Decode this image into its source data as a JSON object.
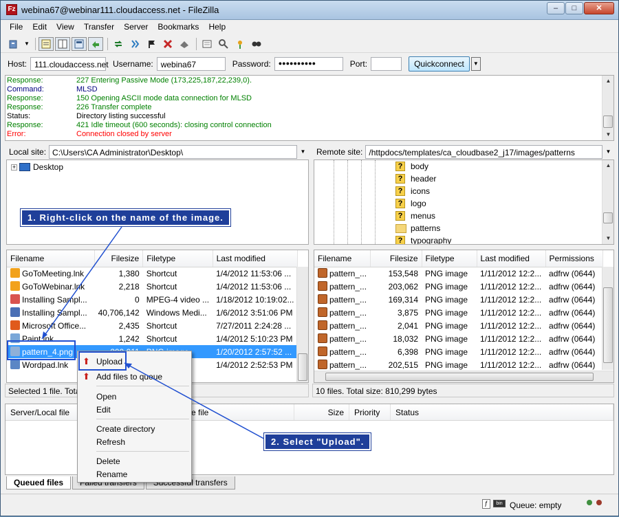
{
  "window": {
    "title": "webina67@webinar111.cloudaccess.net - FileZilla",
    "app_icon": "filezilla-icon",
    "minimize": "–",
    "maximize": "□",
    "close": "✕"
  },
  "menu": [
    "File",
    "Edit",
    "View",
    "Transfer",
    "Server",
    "Bookmarks",
    "Help"
  ],
  "toolbar": {
    "icons": [
      "site-manager-icon",
      "dropdown-icon",
      "message-log-icon",
      "tree-icon",
      "remote-tree-icon",
      "queue-icon",
      "refresh-icon",
      "process-queue-icon",
      "cancel-icon",
      "disconnect-icon",
      "reconnect-icon",
      "filter-icon",
      "compare-icon",
      "sync-browse-icon",
      "search-icon"
    ]
  },
  "quickconnect": {
    "host_label": "Host:",
    "host": "111.cloudaccess.net",
    "user_label": "Username:",
    "user": "webina67",
    "pass_label": "Password:",
    "pass": "●●●●●●●●●●",
    "port_label": "Port:",
    "port": "",
    "button": "Quickconnect"
  },
  "log": [
    {
      "k": "Response:",
      "v": "227 Entering Passive Mode (173,225,187,22,239,0).",
      "c": "#008000"
    },
    {
      "k": "Command:",
      "v": "MLSD",
      "c": "#000080"
    },
    {
      "k": "Response:",
      "v": "150 Opening ASCII mode data connection for MLSD",
      "c": "#008000"
    },
    {
      "k": "Response:",
      "v": "226 Transfer complete",
      "c": "#008000"
    },
    {
      "k": "Status:",
      "v": "Directory listing successful",
      "c": "#000000"
    },
    {
      "k": "Response:",
      "v": "421 Idle timeout (600 seconds): closing control connection",
      "c": "#008000"
    },
    {
      "k": "Error:",
      "v": "Connection closed by server",
      "c": "#ff0000"
    }
  ],
  "local": {
    "label": "Local site:",
    "path": "C:\\Users\\CA Administrator\\Desktop\\",
    "tree_item": "Desktop",
    "headers": [
      "Filename",
      "Filesize",
      "Filetype",
      "Last modified"
    ],
    "files": [
      {
        "name": "GoToMeeting.lnk",
        "size": "1,380",
        "type": "Shortcut",
        "mod": "1/4/2012 11:53:06 ...",
        "color": "#f2a21b"
      },
      {
        "name": "GoToWebinar.lnk",
        "size": "2,218",
        "type": "Shortcut",
        "mod": "1/4/2012 11:53:06 ...",
        "color": "#f2a21b"
      },
      {
        "name": "Installing Sampl...",
        "size": "0",
        "type": "MPEG-4 video ...",
        "mod": "1/18/2012 10:19:02...",
        "color": "#d9534f"
      },
      {
        "name": "Installing Sampl...",
        "size": "40,706,142",
        "type": "Windows Medi...",
        "mod": "1/6/2012 3:51:06 PM",
        "color": "#4a6fb5"
      },
      {
        "name": "Microsoft Office...",
        "size": "2,435",
        "type": "Shortcut",
        "mod": "7/27/2011 2:24:28 ...",
        "color": "#e05a1c"
      },
      {
        "name": "Paint.lnk",
        "size": "1,242",
        "type": "Shortcut",
        "mod": "1/4/2012 5:10:23 PM",
        "color": "#7aa7d8"
      },
      {
        "name": "pattern_4.png",
        "size": "200,011",
        "type": "PNG image",
        "mod": "1/20/2012 2:57:52 ...",
        "color": "#8fb0d8"
      },
      {
        "name": "Wordpad.lnk",
        "size": "",
        "type": "",
        "mod": "1/4/2012 2:52:53 PM",
        "color": "#5b86c5"
      }
    ],
    "status": "Selected 1 file. Tota"
  },
  "remote": {
    "label": "Remote site:",
    "path": "/httpdocs/templates/ca_cloudbase2_j17/images/patterns",
    "tree": [
      "body",
      "header",
      "icons",
      "logo",
      "menus",
      "patterns",
      "typography"
    ],
    "headers": [
      "Filename",
      "Filesize",
      "Filetype",
      "Last modified",
      "Permissions"
    ],
    "files": [
      {
        "name": "pattern_...",
        "size": "153,548",
        "type": "PNG image",
        "mod": "1/11/2012 12:2...",
        "perm": "adfrw (0644)"
      },
      {
        "name": "pattern_...",
        "size": "203,062",
        "type": "PNG image",
        "mod": "1/11/2012 12:2...",
        "perm": "adfrw (0644)"
      },
      {
        "name": "pattern_...",
        "size": "169,314",
        "type": "PNG image",
        "mod": "1/11/2012 12:2...",
        "perm": "adfrw (0644)"
      },
      {
        "name": "pattern_...",
        "size": "3,875",
        "type": "PNG image",
        "mod": "1/11/2012 12:2...",
        "perm": "adfrw (0644)"
      },
      {
        "name": "pattern_...",
        "size": "2,041",
        "type": "PNG image",
        "mod": "1/11/2012 12:2...",
        "perm": "adfrw (0644)"
      },
      {
        "name": "pattern_...",
        "size": "18,032",
        "type": "PNG image",
        "mod": "1/11/2012 12:2...",
        "perm": "adfrw (0644)"
      },
      {
        "name": "pattern_...",
        "size": "6,398",
        "type": "PNG image",
        "mod": "1/11/2012 12:2...",
        "perm": "adfrw (0644)"
      },
      {
        "name": "pattern_...",
        "size": "202,515",
        "type": "PNG image",
        "mod": "1/11/2012 12:2...",
        "perm": "adfrw (0644)"
      }
    ],
    "status": "10 files. Total size: 810,299 bytes"
  },
  "queue": {
    "headers": [
      "Server/Local file",
      "ote file",
      "Size",
      "Priority",
      "Status"
    ],
    "tabs": [
      "Queued files",
      "Failed transfers",
      "Successful transfers"
    ],
    "status": "Queue: empty"
  },
  "context_menu": [
    "Upload",
    "Add files to queue",
    "Open",
    "Edit",
    "Create directory",
    "Refresh",
    "Delete",
    "Rename"
  ],
  "callouts": {
    "step1": "1. Right-click on the name of the image.",
    "step2": "2. Select \"Upload\"."
  }
}
